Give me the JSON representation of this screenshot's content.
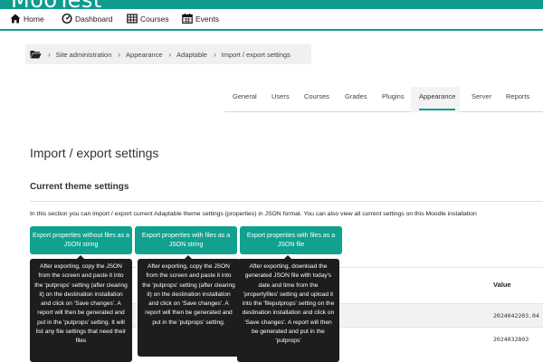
{
  "header": {
    "site_name": "MooTest"
  },
  "nav": {
    "items": [
      {
        "label": "Home",
        "icon": "home-icon"
      },
      {
        "label": "Dashboard",
        "icon": "dashboard-icon"
      },
      {
        "label": "Courses",
        "icon": "courses-icon"
      },
      {
        "label": "Events",
        "icon": "calendar-icon"
      }
    ]
  },
  "breadcrumb": {
    "icon": "folder-icon",
    "items": [
      "Site administration",
      "Appearance",
      "Adaptable",
      "Import / export settings"
    ]
  },
  "tabs": {
    "items": [
      "General",
      "Users",
      "Courses",
      "Grades",
      "Plugins",
      "Appearance",
      "Server",
      "Reports"
    ],
    "active": "Appearance"
  },
  "page": {
    "title": "Import / export settings",
    "section_title": "Current theme settings",
    "intro": "In this section you can import / export current Adaptable theme settings (properties) in JSON format. You can also view all current settings on this Moodle installation"
  },
  "buttons": [
    {
      "label": "Export properties without files as a JSON string",
      "tooltip": "After exporting, copy the JSON from the screen and paste it into the 'putprops' setting (after clearing it) on the destination installation and click on 'Save changes'. A report will then be generated and put in the 'putprops' setting. It will list any file settings that need their files"
    },
    {
      "label": "Export properties with files as a JSON string",
      "tooltip": "After exporting, copy the JSON from the screen and paste it into the 'putprops' setting (after clearing it) on the destination installation and click on 'Save changes'. A report will then be generated and put in the 'putprops' setting."
    },
    {
      "label": "Export properties with files as a JSON file",
      "tooltip": "After exporting, download the generated JSON file with today's date and time from the 'propertyfiles' setting and upload it into the 'fileputprops' setting on the destination installation and click on 'Save changes'. A report will then be generated and put in the 'putprops'"
    }
  ],
  "table": {
    "value_header": "Value",
    "rows": [
      "2024042203.04",
      "2024032803"
    ]
  },
  "colors": {
    "accent": "#0f9b8e",
    "button": "#11a18f",
    "tooltip_bg": "#1d1d1d"
  }
}
